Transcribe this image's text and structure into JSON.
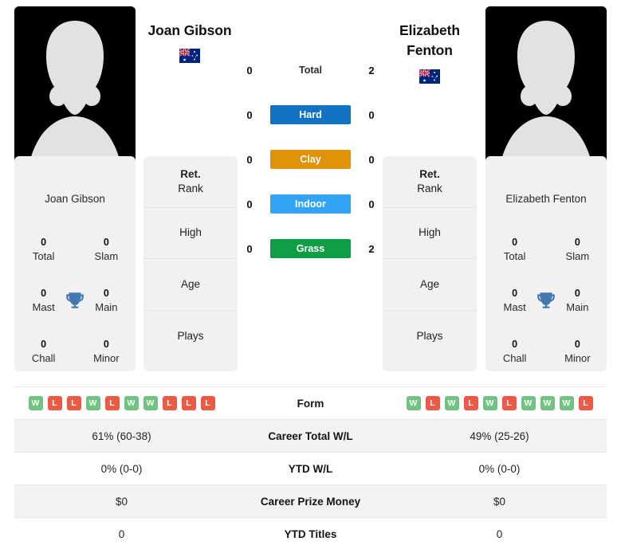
{
  "players": {
    "left": {
      "name": "Joan Gibson",
      "card_name": "Joan Gibson",
      "flag": "australia-flag",
      "titles": {
        "total": {
          "value": "0",
          "label": "Total"
        },
        "slam": {
          "value": "0",
          "label": "Slam"
        },
        "mast": {
          "value": "0",
          "label": "Mast"
        },
        "main": {
          "value": "0",
          "label": "Main"
        },
        "chall": {
          "value": "0",
          "label": "Chall"
        },
        "minor": {
          "value": "0",
          "label": "Minor"
        }
      },
      "attributes": [
        {
          "title": "Ret.",
          "label": "Rank",
          "value": ""
        },
        {
          "title": "",
          "label": "High",
          "value": ""
        },
        {
          "title": "",
          "label": "Age",
          "value": ""
        },
        {
          "title": "",
          "label": "Plays",
          "value": ""
        }
      ],
      "form": [
        "W",
        "L",
        "L",
        "W",
        "L",
        "W",
        "W",
        "L",
        "L",
        "L"
      ],
      "career_total_wl": "61% (60-38)",
      "ytd_wl": "0% (0-0)",
      "career_prize_money": "$0",
      "ytd_titles": "0"
    },
    "right": {
      "name": "Elizabeth Fenton",
      "card_name": "Elizabeth Fenton",
      "flag": "australia-flag",
      "titles": {
        "total": {
          "value": "0",
          "label": "Total"
        },
        "slam": {
          "value": "0",
          "label": "Slam"
        },
        "mast": {
          "value": "0",
          "label": "Mast"
        },
        "main": {
          "value": "0",
          "label": "Main"
        },
        "chall": {
          "value": "0",
          "label": "Chall"
        },
        "minor": {
          "value": "0",
          "label": "Minor"
        }
      },
      "attributes": [
        {
          "title": "Ret.",
          "label": "Rank",
          "value": ""
        },
        {
          "title": "",
          "label": "High",
          "value": ""
        },
        {
          "title": "",
          "label": "Age",
          "value": ""
        },
        {
          "title": "",
          "label": "Plays",
          "value": ""
        }
      ],
      "form": [
        "W",
        "L",
        "W",
        "L",
        "W",
        "L",
        "W",
        "W",
        "W",
        "L"
      ],
      "career_total_wl": "49% (25-26)",
      "ytd_wl": "0% (0-0)",
      "career_prize_money": "$0",
      "ytd_titles": "0"
    }
  },
  "head_to_head": [
    {
      "label": "Total",
      "left": "0",
      "right": "2",
      "color": "",
      "plain": true
    },
    {
      "label": "Hard",
      "left": "0",
      "right": "0",
      "color": "#1273c4",
      "plain": false
    },
    {
      "label": "Clay",
      "left": "0",
      "right": "0",
      "color": "#e09208",
      "plain": false
    },
    {
      "label": "Indoor",
      "left": "0",
      "right": "0",
      "color": "#33a3f5",
      "plain": false
    },
    {
      "label": "Grass",
      "left": "0",
      "right": "2",
      "color": "#0f9e45",
      "plain": false
    }
  ],
  "comparison_rows": [
    {
      "label": "Form",
      "type": "form"
    },
    {
      "label": "Career Total W/L",
      "type": "text"
    },
    {
      "label": "YTD W/L",
      "type": "text"
    },
    {
      "label": "Career Prize Money",
      "type": "text"
    },
    {
      "label": "YTD Titles",
      "type": "text"
    }
  ],
  "colors": {
    "win_badge": "#72c282",
    "loss_badge": "#ee5a44",
    "trophy": "#4478b0",
    "card_bg": "#f1f1f1",
    "row_shade": "#f2f2f2"
  },
  "icons": {
    "trophy": "trophy-icon",
    "avatar": "person-silhouette-icon"
  }
}
